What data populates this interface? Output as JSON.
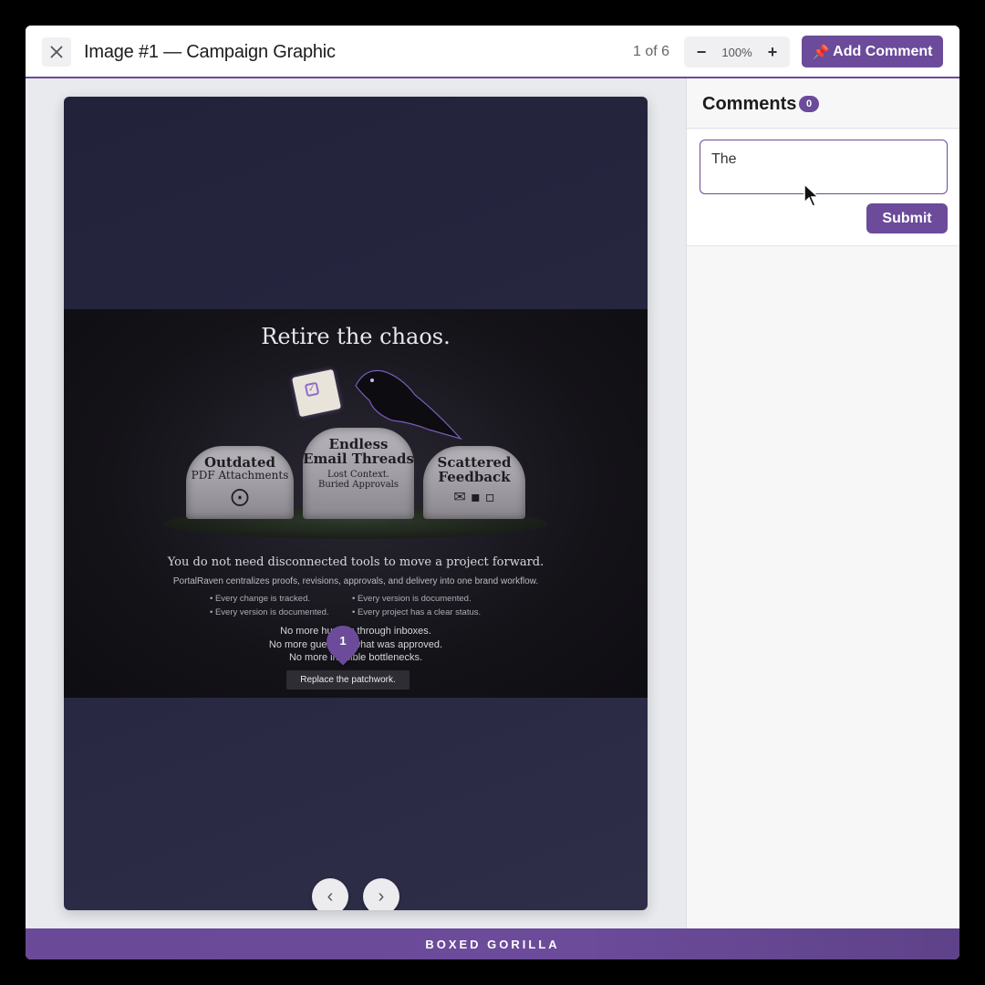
{
  "header": {
    "title": "Image #1 — Campaign Graphic",
    "pager": "1 of 6",
    "zoom_out": "−",
    "zoom_level": "100%",
    "zoom_in": "+",
    "add_comment_icon": "pushpin-icon",
    "add_comment_label": "Add Comment"
  },
  "graphic": {
    "headline": "Retire the chaos.",
    "stones": [
      {
        "title": "Outdated",
        "subtitle": "PDF Attachments",
        "small": ""
      },
      {
        "title": "Endless\nEmail Threads",
        "subtitle": "",
        "small": "Lost Context.\nBuried Approvals"
      },
      {
        "title": "Scattered\nFeedback",
        "subtitle": "",
        "small": ""
      }
    ],
    "subhead": "You do not need disconnected tools to move a project forward.",
    "body": "PortalRaven centralizes proofs, revisions, approvals, and delivery into one brand workflow.",
    "bullets": [
      "• Every change is tracked.",
      "• Every version is documented.",
      "• Every version is documented.",
      "• Every project has a clear status."
    ],
    "lines": [
      "No more hunting through inboxes.",
      "No more guessing what was approved.",
      "No more invisible bottlenecks."
    ],
    "cta": "Replace the patchwork."
  },
  "pin": {
    "number": "1"
  },
  "nav": {
    "prev": "‹",
    "next": "›"
  },
  "sidebar": {
    "title": "Comments",
    "count": "0",
    "input_value": "The",
    "submit_label": "Submit"
  },
  "footer": {
    "brand": "BOXED GORILLA"
  },
  "colors": {
    "accent": "#6b4b9a",
    "canvas": "#24243c",
    "footer": "#6b4b9a"
  }
}
